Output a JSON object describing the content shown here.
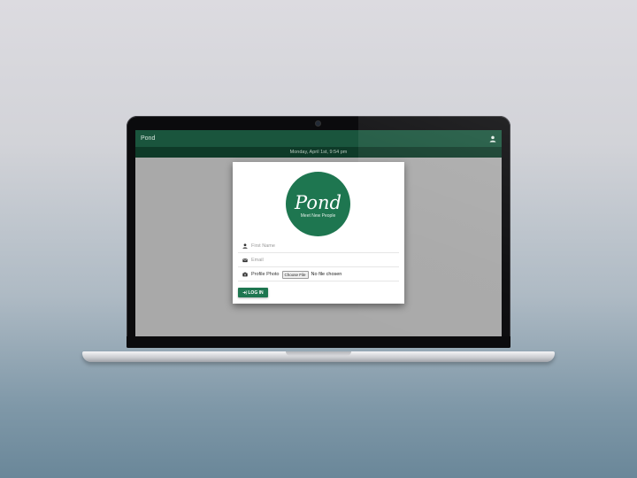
{
  "app": {
    "brand": "Pond",
    "date_banner": "Monday, April 1st, 9:54 pm"
  },
  "icons": {
    "account": "account-icon",
    "person": "person-icon",
    "envelope": "envelope-icon",
    "camera": "camera-icon",
    "login": "login-arrow-icon"
  },
  "logo": {
    "text": "Pond",
    "tagline": "Meet New People"
  },
  "form": {
    "first_name_placeholder": "First Name",
    "email_placeholder": "Email",
    "photo_label": "Profile Photo",
    "choose_file_label": "Choose File",
    "no_file_text": "No file chosen",
    "login_label": "LOG IN"
  },
  "colors": {
    "appbar": "#1a553d",
    "datebar": "#0e3a28",
    "accent": "#1e7650"
  }
}
